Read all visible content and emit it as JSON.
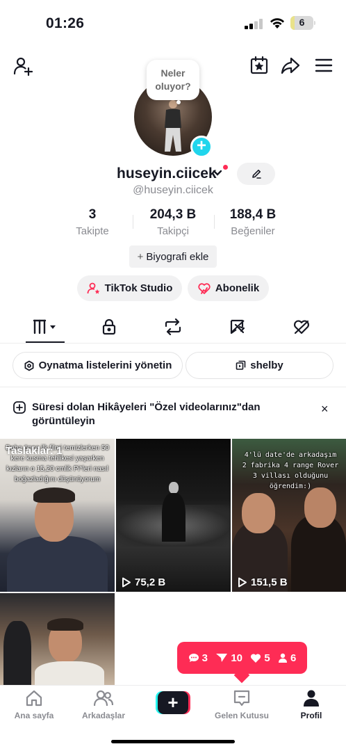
{
  "status_bar": {
    "time": "01:26",
    "battery": "6",
    "battery_level_percent": 6,
    "icons": [
      "cellular-signal-icon",
      "wifi-icon",
      "battery-icon"
    ]
  },
  "top_bar": {
    "icons": [
      "add-friend-icon",
      "calendar-star-icon",
      "share-icon",
      "menu-icon"
    ]
  },
  "profile": {
    "bubble_text_1": "Neler",
    "bubble_text_2": "oluyor?",
    "username": "huseyin.ciicek",
    "handle": "@huseyin.ciicek",
    "stats": [
      {
        "value": "3",
        "label": "Takipte"
      },
      {
        "value": "204,3 B",
        "label": "Takipçi"
      },
      {
        "value": "188,4 B",
        "label": "Beğeniler"
      }
    ],
    "bio_button": "Biyografi ekle",
    "bio_plus": "+",
    "studio_button": "TikTok Studio",
    "subscription_button": "Abonelik"
  },
  "tabs": {
    "icons": [
      "videos-grid-icon",
      "lock-icon",
      "repost-icon",
      "favorites-icon",
      "liked-icon"
    ],
    "active_index": 0
  },
  "actions": {
    "playlists_button": "Oynatma listelerini yönetin",
    "playlist_name": "shelby"
  },
  "story_notice": {
    "text": "Süresi dolan Hikâyeleri \"Özel videolarınız\"dan görüntüleyin",
    "close": "×"
  },
  "grid": {
    "tiles": [
      {
        "draft_label": "Taslaklar: 1",
        "caption": "Daha önce ilk filmi temizlerken 50 kere kusma tehlikesi yaşarken kızların o 15,20 cmlik Pi*leri nasıl boğazladığını düşünüyorum",
        "views": ""
      },
      {
        "caption": "",
        "views": "75,2 B"
      },
      {
        "caption": "4'lü date'de arkadaşım 2 fabrika 4 range Rover 3 villası olduğunu öğrendim:)",
        "views": "151,5 B"
      },
      {
        "caption": "",
        "views": ""
      }
    ]
  },
  "toast": {
    "comments": "3",
    "follows": "10",
    "likes": "5",
    "people": "6"
  },
  "bottom_nav": {
    "home": "Ana sayfa",
    "friends": "Arkadaşlar",
    "create": "+",
    "inbox": "Gelen Kutusu",
    "profile": "Profil",
    "active": "profile"
  }
}
